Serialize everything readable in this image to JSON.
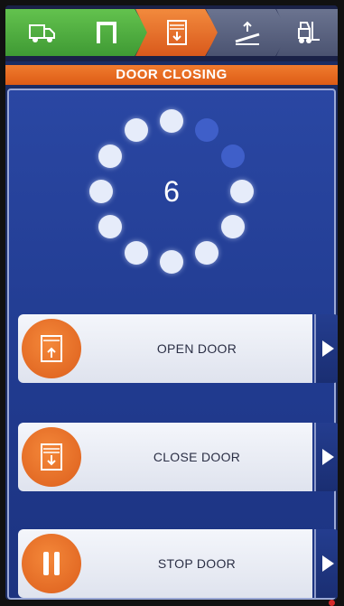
{
  "steps": [
    {
      "icon": "truck-icon",
      "state": "done",
      "color": "#4fae3f"
    },
    {
      "icon": "dock-door-icon",
      "state": "done",
      "color": "#4fae3f"
    },
    {
      "icon": "door-closing-icon",
      "state": "active",
      "color": "#e8692a"
    },
    {
      "icon": "dock-leveler-icon",
      "state": "pending",
      "color": "#5a6280"
    },
    {
      "icon": "forklift-icon",
      "state": "pending",
      "color": "#5a6280"
    }
  ],
  "header": {
    "title": "DOOR CLOSING"
  },
  "countdown": {
    "value": "6",
    "dots_total": 12,
    "dots_remaining": 10
  },
  "actions": [
    {
      "label": "OPEN DOOR",
      "icon": "door-open-icon"
    },
    {
      "label": "CLOSE DOOR",
      "icon": "door-close-icon"
    },
    {
      "label": "STOP DOOR",
      "icon": "pause-icon"
    }
  ],
  "colors": {
    "accent_orange": "#e8692a",
    "panel_blue": "#2540a0",
    "dot_bright": "#e6ecfa",
    "dot_dim": "#3f5fc9",
    "done_green": "#4fae3f"
  }
}
